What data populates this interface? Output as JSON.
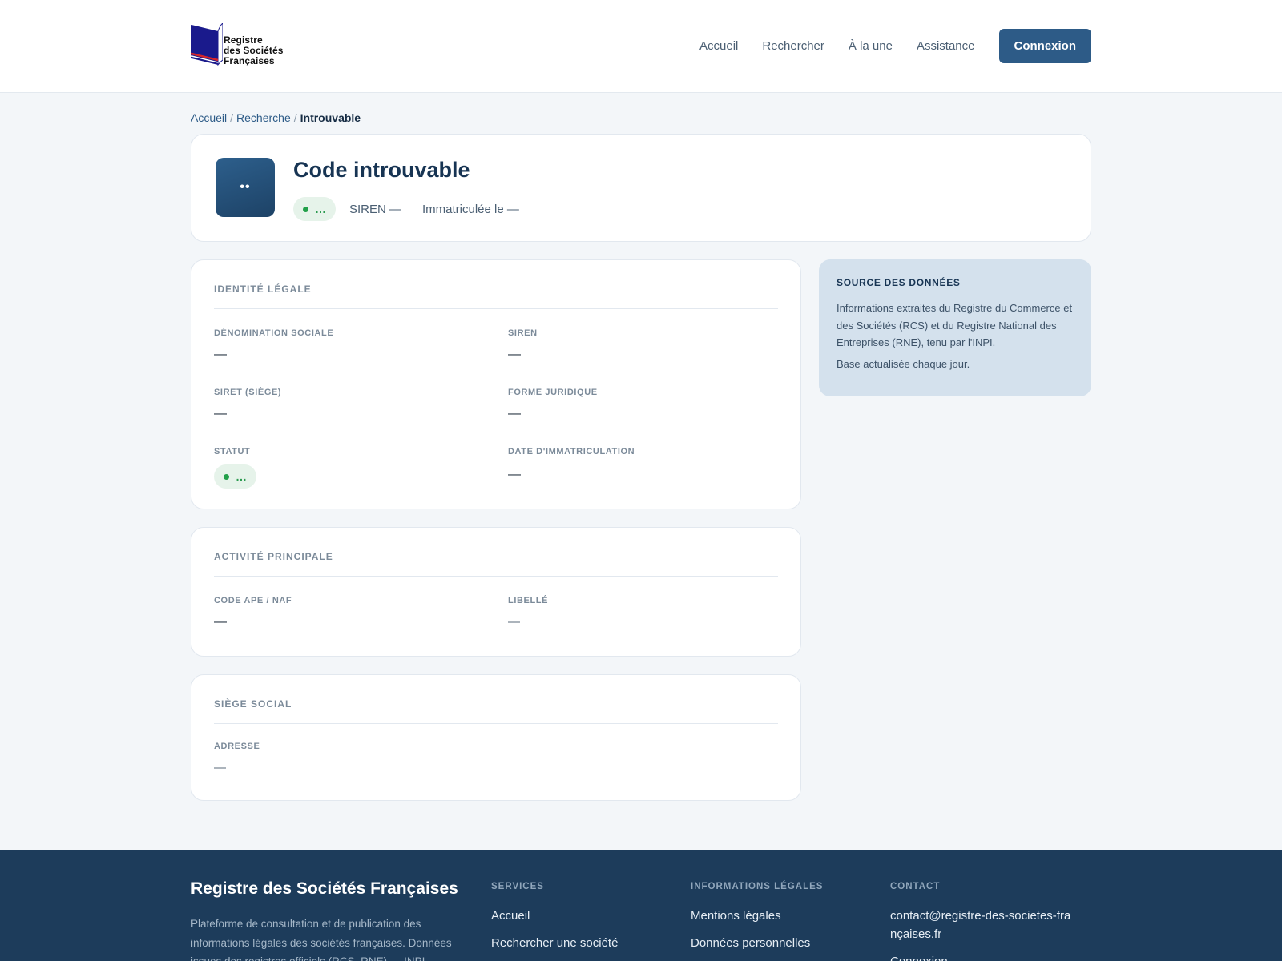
{
  "header": {
    "logo": {
      "line1": "Registre",
      "line2": "des Sociétés",
      "line3": "Françaises"
    },
    "nav": [
      "Accueil",
      "Rechercher",
      "À la une",
      "Assistance"
    ],
    "login_button": "Connexion"
  },
  "breadcrumb": {
    "items": [
      "Accueil",
      "Recherche"
    ],
    "current": "Introuvable",
    "separator": "/"
  },
  "hero": {
    "avatar_text": "••",
    "title": "Code introuvable",
    "status_text": "…",
    "siren_text": "SIREN —",
    "registered_text": "Immatriculée le —"
  },
  "identite": {
    "title": "IDENTITÉ LÉGALE",
    "denomination_label": "DÉNOMINATION SOCIALE",
    "denomination_value": "—",
    "siren_label": "SIREN",
    "siren_value": "—",
    "siret_label": "SIRET (SIÈGE)",
    "siret_value": "—",
    "forme_label": "FORME JURIDIQUE",
    "forme_value": "—",
    "statut_label": "STATUT",
    "statut_value": "…",
    "date_label": "DATE D'IMMATRICULATION",
    "date_value": "—"
  },
  "activite": {
    "title": "ACTIVITÉ PRINCIPALE",
    "code_label": "CODE APE / NAF",
    "code_value": "—",
    "libelle_label": "LIBELLÉ",
    "libelle_value": "—"
  },
  "siege": {
    "title": "SIÈGE SOCIAL",
    "adresse_label": "ADRESSE",
    "adresse_value": "—"
  },
  "source": {
    "title": "SOURCE DES DONNÉES",
    "text": "Informations extraites du Registre du Commerce et des Sociétés (RCS) et du Registre National des Entreprises (RNE), tenu par l'INPI.",
    "update": "Base actualisée chaque jour."
  },
  "footer": {
    "brand": "Registre des Sociétés Françaises",
    "description": "Plateforme de consultation et de publication des informations légales des sociétés françaises. Données issues des registres officiels (RCS, RNE) — INPI.",
    "services": {
      "title": "SERVICES",
      "links": [
        "Accueil",
        "Rechercher une société"
      ]
    },
    "legal": {
      "title": "INFORMATIONS LÉGALES",
      "links": [
        "Mentions légales",
        "Données personnelles"
      ]
    },
    "contact": {
      "title": "CONTACT",
      "email": "contact@registre-des-societes-françaises.fr",
      "link": "Connexion"
    }
  },
  "colors": {
    "primary": "#2d5b87",
    "navy": "#1d3c5b",
    "status_green": "#22a04a",
    "source_bg": "#d4e1ed"
  }
}
